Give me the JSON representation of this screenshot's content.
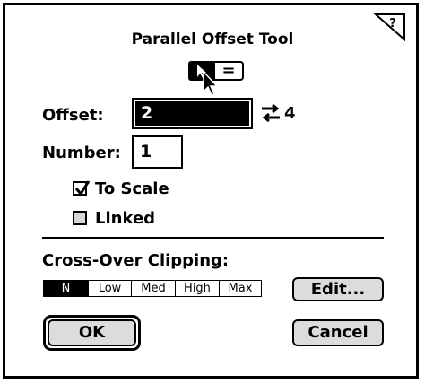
{
  "dialog": {
    "title": "Parallel Offset Tool",
    "help_icon": "help-triangle-icon",
    "mode": {
      "arrow_icon": "arrow-icon",
      "equal_label": "="
    },
    "offset": {
      "label": "Offset:",
      "value": "2",
      "swap_icon": "swap-arrows-icon",
      "swap_value": "4"
    },
    "number": {
      "label": "Number:",
      "value": "1"
    },
    "to_scale": {
      "label": "To Scale",
      "checked": true
    },
    "linked": {
      "label": "Linked",
      "checked": false
    },
    "cross_over": {
      "label": "Cross-Over Clipping:",
      "options": [
        "N",
        "Low",
        "Med",
        "High",
        "Max"
      ],
      "selected": "N",
      "edit_label": "Edit..."
    },
    "ok_label": "OK",
    "cancel_label": "Cancel"
  }
}
